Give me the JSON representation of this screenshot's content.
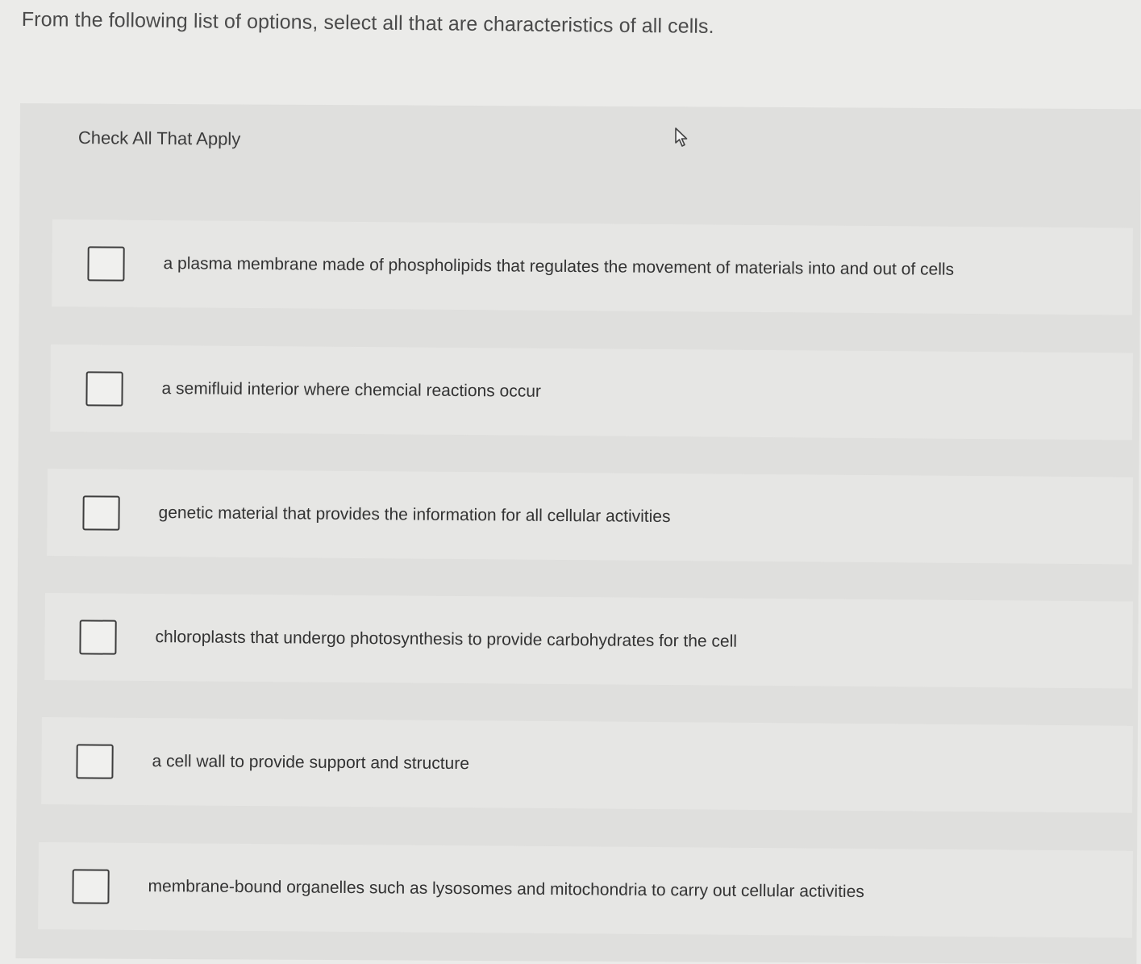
{
  "question": {
    "text": "From the following list of options, select all that are characteristics of all cells."
  },
  "instruction": {
    "text": "Check All That Apply"
  },
  "options": [
    {
      "label": "a plasma membrane made of phospholipids that regulates the movement of materials into and out of cells",
      "checked": false
    },
    {
      "label": "a semifluid interior where chemcial reactions occur",
      "checked": false
    },
    {
      "label": "genetic material that provides the information for all cellular activities",
      "checked": false
    },
    {
      "label": "chloroplasts that undergo photosynthesis to provide carbohydrates for the cell",
      "checked": false
    },
    {
      "label": "a cell wall to provide support and structure",
      "checked": false
    },
    {
      "label": "membrane-bound organelles such as lysosomes and mitochondria to carry out cellular activities",
      "checked": false
    }
  ]
}
